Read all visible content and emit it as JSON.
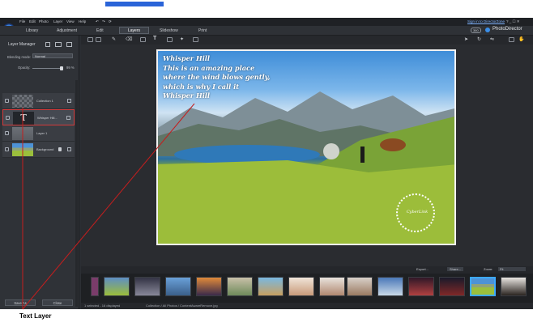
{
  "menu": {
    "items": [
      "File",
      "Edit",
      "Photo",
      "Layer",
      "View",
      "Help"
    ],
    "right_link": "Sign in to DirectorZone",
    "window_controls": "? _ ☐ ✕"
  },
  "modes": {
    "tabs": [
      "Library",
      "Adjustment",
      "Edit",
      "Layers",
      "Slideshow",
      "Print"
    ],
    "active": "Layers"
  },
  "brand": {
    "badge": "360",
    "name": "PhotoDirector"
  },
  "layer_manager": {
    "title": "Layer Manager",
    "blending_label": "Blending mode:",
    "blending_value": "Normal",
    "opacity_label": "Opacity:",
    "opacity_value": "99 %",
    "opacity_level": 0.95,
    "layers": [
      {
        "name": "Collection 1"
      },
      {
        "name": "Whisper Hill..."
      },
      {
        "name": "Layer 1"
      },
      {
        "name": "Background"
      }
    ],
    "save_button": "Save As",
    "close_button": "Close"
  },
  "photo_text": [
    "Whisper Hill",
    "  This is an amazing place",
    "where the wind blows gently,",
    "which is why I call it",
    "Whisper Hill"
  ],
  "stamp_text": "CyberLink",
  "filmbar": {
    "export_label": "Export...",
    "share_label": "Share...",
    "zoom_label": "Zoom:",
    "zoom_value": "Fit"
  },
  "status": {
    "selected": "1 selected - 16 displayed",
    "path": "Collection / All Photos / ContentAwareRemove.jpg"
  },
  "annotation": "Text Layer",
  "colors": {
    "annotation_line": "#c41e1e",
    "selection": "#3da9ff",
    "accent": "#2a64d8"
  }
}
